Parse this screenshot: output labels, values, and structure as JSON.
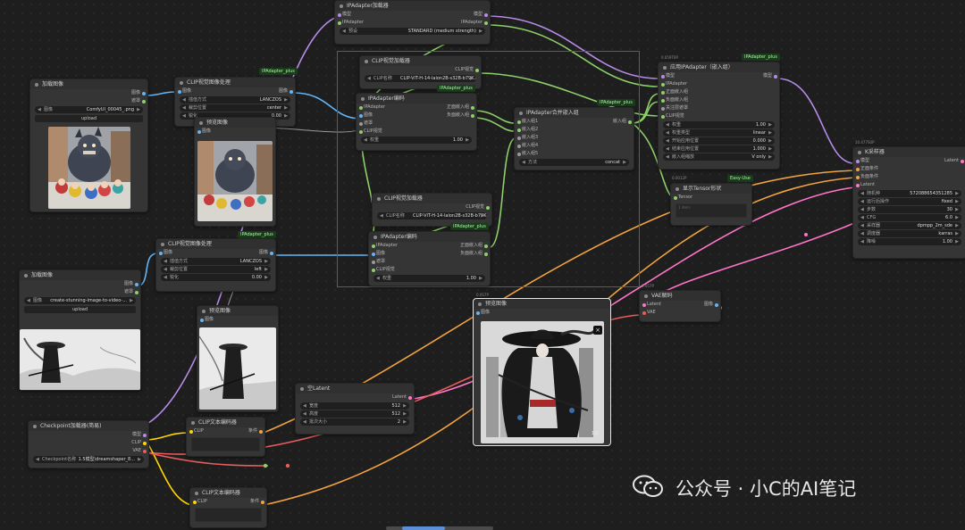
{
  "canvas": {
    "background": "#1e1e1e",
    "selection_color": "#e02424"
  },
  "nodes": {
    "ipadapter_loader": {
      "title": "IPAdapter加载器",
      "in_model": "模型",
      "in_ipadapter": "IPAdapter",
      "out_model": "模型",
      "out_ipadapter": "IPAdapter",
      "w_preset_label": "预设",
      "w_preset_value": "STANDARD (medium strength)"
    },
    "load_image_1": {
      "title": "加载图像",
      "out_image": "图像",
      "out_mask": "遮罩",
      "w_image_label": "图像",
      "w_image_value": "ComfyUI_00045_.png",
      "upload": "upload"
    },
    "clip_prep_1": {
      "title": "CLIP视觉图像处理",
      "in_image": "图像",
      "out_image": "图像",
      "w1_label": "插值方式",
      "w1_value": "LANCZOS",
      "w2_label": "裁剪位置",
      "w2_value": "center",
      "w3_label": "锐化",
      "w3_value": "0.00",
      "tag": "IPAdapter_plus"
    },
    "preview_1": {
      "title": "预览图像",
      "in_image": "图像"
    },
    "clip_loader_1": {
      "title": "CLIP视觉加载器",
      "out_clip": "CLIP视觉",
      "w_label": "CLIP名称",
      "w_value": "CLIP-ViT-H-14-laion2B-s32B-b79K.safetensors"
    },
    "ipadapter_encoder_1": {
      "title": "IPAdapter编码",
      "tag": "IPAdapter_plus",
      "in_ipadapter": "IPAdapter",
      "in_image": "图像",
      "in_mask": "遮罩",
      "in_clip": "CLIP视觉",
      "out_pos": "正面嵌入组",
      "out_neg": "负面嵌入组",
      "w_label": "权重",
      "w_value": "1.00"
    },
    "combine_embeds": {
      "title": "IPAdapter合并嵌入组",
      "tag": "IPAdapter_plus",
      "in1": "嵌入组1",
      "in2": "嵌入组2",
      "in3": "嵌入组3",
      "in4": "嵌入组4",
      "in5": "嵌入组5",
      "out": "嵌入组",
      "w_label": "方法",
      "w_value": "concat"
    },
    "apply_ipadapter": {
      "title": "应用IPAdapter（嵌入组）",
      "badge": "0.059T0P",
      "tag": "IPAdapter_plus",
      "in_model": "模型",
      "in_ipadapter": "IPAdapter",
      "in_pos": "正面嵌入组",
      "in_neg": "负面嵌入组",
      "in_attn": "关注层遮罩",
      "in_clip": "CLIP视觉",
      "out_model": "模型",
      "w1_label": "权重",
      "w1_value": "1.00",
      "w2_label": "权重类型",
      "w2_value": "linear",
      "w3_label": "开始应用位置",
      "w3_value": "0.000",
      "w4_label": "结束应用位置",
      "w4_value": "1.000",
      "w5_label": "嵌入组缩放",
      "w5_value": "V only"
    },
    "show_tensor": {
      "title": "显示Tensor形状",
      "badge": "0.0012P",
      "tag": "Easy-Use",
      "in_tensor": "Tensor",
      "text": "1 item"
    },
    "ksampler": {
      "title": "K采样器",
      "badge": "10.477S0P",
      "in_model": "模型",
      "in_pos": "正面条件",
      "in_neg": "负面条件",
      "in_latent": "Latent",
      "out_latent": "Latent",
      "w1_label": "随机种",
      "w1_value": "572088654351285",
      "w2_label": "运行后操作",
      "w2_value": "fixed",
      "w3_label": "步数",
      "w3_value": "30",
      "w4_label": "CFG",
      "w4_value": "6.0",
      "w5_label": "采样器",
      "w5_value": "dpmpp_2m_sde",
      "w6_label": "调度器",
      "w6_value": "karras",
      "w7_label": "降噪",
      "w7_value": "1.00"
    },
    "clip_loader_2": {
      "title": "CLIP视觉加载器",
      "out_clip": "CLIP视觉",
      "w_label": "CLIP名称",
      "w_value": "CLIP-ViT-H-14-laion2B-s32B-b79K.safetensors",
      "tag": "IPAdapter_plus"
    },
    "ipadapter_encoder_2": {
      "title": "IPAdapter编码",
      "in_ipadapter": "IPAdapter",
      "in_image": "图像",
      "in_mask": "遮罩",
      "in_clip": "CLIP视觉",
      "out_pos": "正面嵌入组",
      "out_neg": "负面嵌入组",
      "w_label": "权重",
      "w_value": "1.00"
    },
    "clip_prep_2": {
      "title": "CLIP视觉图像处理",
      "in_image": "图像",
      "out_image": "图像",
      "w1_label": "插值方式",
      "w1_value": "LANCZOS",
      "w2_label": "裁剪位置",
      "w2_value": "left",
      "w3_label": "锐化",
      "w3_value": "0.00",
      "tag": "IPAdapter_plus"
    },
    "load_image_2": {
      "title": "加载图像",
      "out_image": "图像",
      "out_mask": "遮罩",
      "w_image_label": "图像",
      "w_image_value": "create-stunning-image-to-video-...",
      "upload": "upload"
    },
    "preview_2": {
      "title": "预览图像",
      "in_image": "图像"
    },
    "preview_main": {
      "title": "预览图像",
      "badge": "0.0S7P",
      "in_image": "图像",
      "counter": "1/2",
      "close": "×"
    },
    "vae_decode": {
      "title": "VAE解码",
      "badge": "0.057P",
      "in_latent": "Latent",
      "in_vae": "VAE",
      "out_image": "图像"
    },
    "empty_latent": {
      "title": "空Latent",
      "out_latent": "Latent",
      "w1_label": "宽度",
      "w1_value": "512",
      "w2_label": "高度",
      "w2_value": "512",
      "w3_label": "批次大小",
      "w3_value": "2"
    },
    "checkpoint": {
      "title": "Checkpoint加载器(简易)",
      "out_model": "模型",
      "out_clip": "CLIP",
      "out_vae": "VAE",
      "w_label": "Checkpoint名称",
      "w_value": "1.5模型\\dreamshaper_8..."
    },
    "clip_text_1": {
      "title": "CLIP文本编码器",
      "in_clip": "CLIP",
      "out_cond": "条件"
    },
    "clip_text_2": {
      "title": "CLIP文本编码器",
      "in_clip": "CLIP",
      "out_cond": "条件"
    }
  },
  "watermark": {
    "text": "公众号 · 小C的AI笔记",
    "icon": "wechat-icon"
  }
}
